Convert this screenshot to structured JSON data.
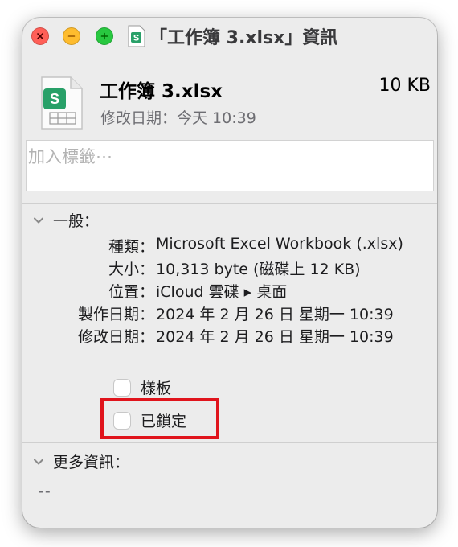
{
  "window": {
    "title": "「工作簿 3.xlsx」資訊"
  },
  "file": {
    "name": "工作簿 3.xlsx",
    "size": "10 KB",
    "modified": "修改日期：今天 10:39",
    "icon_glyph": "S",
    "accent_color": "#28a068"
  },
  "tags": {
    "placeholder": "加入標籤⋯"
  },
  "general": {
    "header": "一般：",
    "rows": [
      {
        "key": "種類",
        "value": "Microsoft Excel Workbook (.xlsx)"
      },
      {
        "key": "大小",
        "value": "10,313 byte (磁碟上 12 KB)"
      },
      {
        "key": "位置",
        "value": "iCloud 雲碟 ▸ 桌面"
      },
      {
        "key": "製作日期",
        "value": "2024 年 2 月 26 日 星期一 10:39"
      },
      {
        "key": "修改日期",
        "value": "2024 年 2 月 26 日 星期一 10:39"
      }
    ],
    "colon": "：",
    "stationery_label": "樣板",
    "locked_label": "已鎖定",
    "highlight_color": "#e0141c"
  },
  "more_info": {
    "header": "更多資訊：",
    "value": "--"
  }
}
